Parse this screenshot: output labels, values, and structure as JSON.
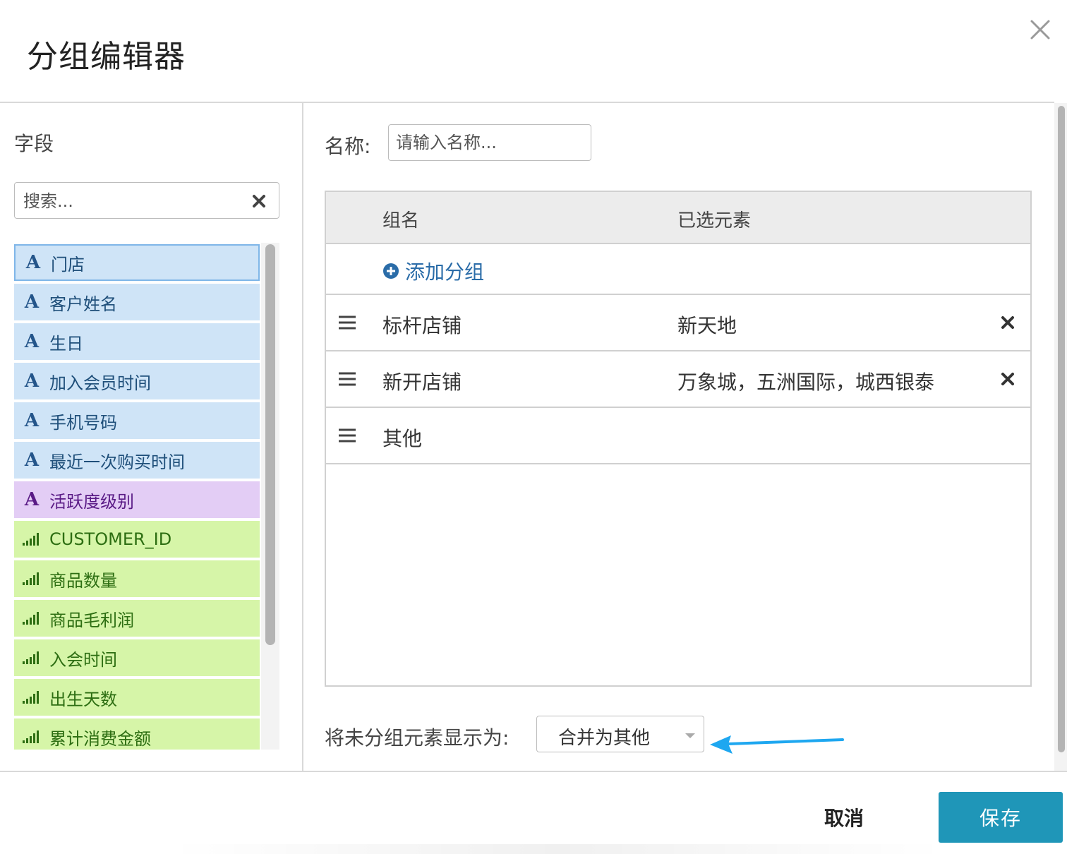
{
  "dialog": {
    "title": "分组编辑器",
    "colors": {
      "primary": "#1f96b8",
      "link": "#2a6ca8",
      "dimension_bg": "#cfe4f7",
      "purple_bg": "#e3cdf5",
      "measure_bg": "#d6f5a8",
      "arrow": "#1ea7f0"
    }
  },
  "fields_panel": {
    "label": "字段",
    "search": {
      "placeholder": "搜索...",
      "value": ""
    },
    "items": [
      {
        "label": "门店",
        "type": "dimension",
        "icon": "A",
        "selected": true
      },
      {
        "label": "客户姓名",
        "type": "dimension",
        "icon": "A"
      },
      {
        "label": "生日",
        "type": "dimension",
        "icon": "A"
      },
      {
        "label": "加入会员时间",
        "type": "dimension",
        "icon": "A"
      },
      {
        "label": "手机号码",
        "type": "dimension",
        "icon": "A"
      },
      {
        "label": "最近一次购买时间",
        "type": "dimension",
        "icon": "A"
      },
      {
        "label": "活跃度级别",
        "type": "custom",
        "icon": "A"
      },
      {
        "label": "CUSTOMER_ID",
        "type": "measure",
        "icon": "bar-signal-icon"
      },
      {
        "label": "商品数量",
        "type": "measure",
        "icon": "bar-signal-icon"
      },
      {
        "label": "商品毛利润",
        "type": "measure",
        "icon": "bar-signal-icon"
      },
      {
        "label": "入会时间",
        "type": "measure",
        "icon": "bar-signal-icon"
      },
      {
        "label": "出生天数",
        "type": "measure",
        "icon": "bar-signal-icon"
      },
      {
        "label": "累计消费金额",
        "type": "measure",
        "icon": "bar-signal-icon"
      }
    ]
  },
  "editor": {
    "name_label": "名称:",
    "name_placeholder": "请输入名称...",
    "name_value": "",
    "table": {
      "headers": {
        "group_name": "组名",
        "selected_elements": "已选元素"
      },
      "add_group_label": "添加分组",
      "rows": [
        {
          "name": "标杆店铺",
          "elements": "新天地"
        },
        {
          "name": "新开店铺",
          "elements": "万象城，五洲国际，城西银泰"
        },
        {
          "name": "其他",
          "elements": ""
        }
      ]
    },
    "ungrouped_label": "将未分组元素显示为:",
    "ungrouped_value": "合并为其他"
  },
  "footer": {
    "cancel_label": "取消",
    "save_label": "保存"
  }
}
